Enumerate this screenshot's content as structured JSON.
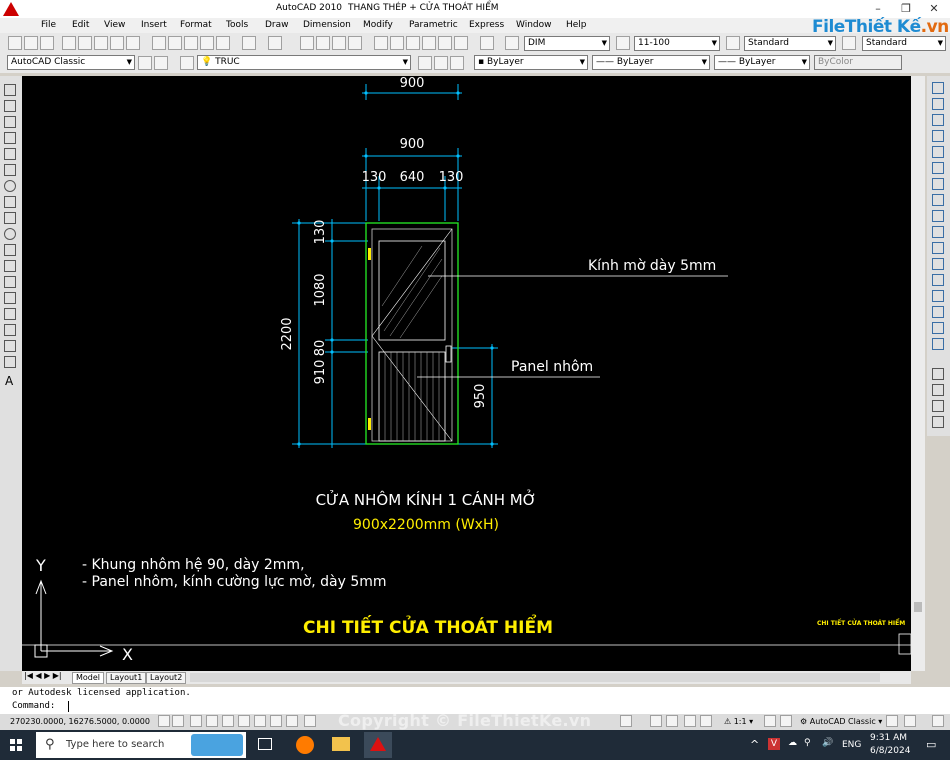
{
  "window": {
    "app_title": "AutoCAD 2010",
    "doc_title": "THANG THÉP + CỬA THOÁT HIỂM"
  },
  "menu": [
    "File",
    "Edit",
    "View",
    "Insert",
    "Format",
    "Tools",
    "Draw",
    "Dimension",
    "Modify",
    "Parametric",
    "Express",
    "Window",
    "Help"
  ],
  "toolbar": {
    "text_style": "DIM",
    "dim_style": "11-100",
    "table_style": "Standard",
    "multileader_style": "Standard",
    "workspace": "AutoCAD Classic",
    "layer": "TRUC",
    "color": "ByLayer",
    "linetype": "ByLayer",
    "lineweight": "ByLayer",
    "plotstyle": "ByColor"
  },
  "brand": {
    "part1": "File",
    "part2": "Thiết Kế",
    "part3": ".vn"
  },
  "drawing": {
    "dims": {
      "top_width_a": "900",
      "top_width_b": "900",
      "seg_left": "130",
      "seg_mid": "640",
      "seg_right": "130",
      "height_total": "2200",
      "h1": "130",
      "h2": "1080",
      "h3": "80",
      "h4": "910",
      "h_panel": "950"
    },
    "label_glass": "Kính mờ dày 5mm",
    "label_panel": "Panel nhôm",
    "title": "CỬA NHÔM KÍNH 1 CÁNH MỞ",
    "subtitle": "900x2200mm (WxH)",
    "note1": "- Khung nhôm hệ 90, dày 2mm,",
    "note2": "- Panel nhôm, kính cường lực mờ, dày 5mm",
    "heading": "CHI TIẾT CỬA THOÁT HIỂM",
    "heading_small": "CHI TIẾT CỬA THOÁT HIỂM",
    "ucs_x": "X",
    "ucs_y": "Y"
  },
  "tabs": [
    "Model",
    "Layout1",
    "Layout2"
  ],
  "command": {
    "history": "or Autodesk licensed application.",
    "prompt": "Command:"
  },
  "status": {
    "coords": "270230.0000, 16276.5000, 0.0000",
    "annotation_scale": "1:1",
    "workspace": "AutoCAD Classic"
  },
  "watermark": "Copyright © FileThietKe.vn",
  "taskbar": {
    "search_placeholder": "Type here to search",
    "lang": "ENG",
    "time": "9:31 AM",
    "date": "6/8/2024"
  },
  "colors": {
    "canvas_bg": "#000000",
    "dim_cyan": "#00bfff",
    "door_green": "#22dd22",
    "heading_yellow": "#ffee00",
    "brand_blue": "#1e8bd2",
    "brand_orange": "#e26a10"
  }
}
